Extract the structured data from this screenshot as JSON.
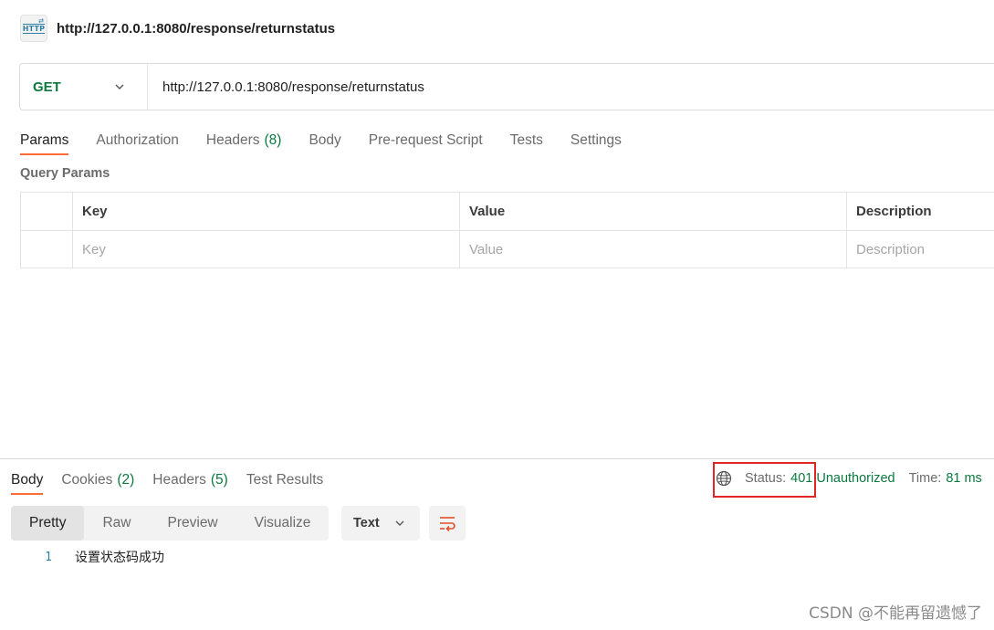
{
  "header": {
    "icon": "http-icon",
    "title": "http://127.0.0.1:8080/response/returnstatus"
  },
  "request": {
    "method": "GET",
    "url": "http://127.0.0.1:8080/response/returnstatus",
    "tabs": [
      {
        "label": "Params",
        "count": ""
      },
      {
        "label": "Authorization",
        "count": ""
      },
      {
        "label": "Headers",
        "count": "(8)"
      },
      {
        "label": "Body",
        "count": ""
      },
      {
        "label": "Pre-request Script",
        "count": ""
      },
      {
        "label": "Tests",
        "count": ""
      },
      {
        "label": "Settings",
        "count": ""
      }
    ],
    "query_params_title": "Query Params",
    "table": {
      "headers": {
        "key": "Key",
        "value": "Value",
        "description": "Description"
      },
      "placeholders": {
        "key": "Key",
        "value": "Value",
        "description": "Description"
      }
    }
  },
  "response": {
    "tabs": [
      {
        "label": "Body",
        "count": ""
      },
      {
        "label": "Cookies",
        "count": "(2)"
      },
      {
        "label": "Headers",
        "count": "(5)"
      },
      {
        "label": "Test Results",
        "count": ""
      }
    ],
    "status_label": "Status:",
    "status_code": "401",
    "status_text": "Unauthorized",
    "time_label": "Time:",
    "time_value": "81 ms",
    "views": [
      "Pretty",
      "Raw",
      "Preview",
      "Visualize"
    ],
    "format": "Text",
    "lines": [
      {
        "num": "1",
        "code": "设置状态码成功"
      }
    ]
  },
  "watermark": "CSDN @不能再留遗憾了",
  "colors": {
    "accent": "#ff6c37",
    "success": "#0b7a3e",
    "highlight": "#e02525",
    "link": "#2f7fa6"
  }
}
